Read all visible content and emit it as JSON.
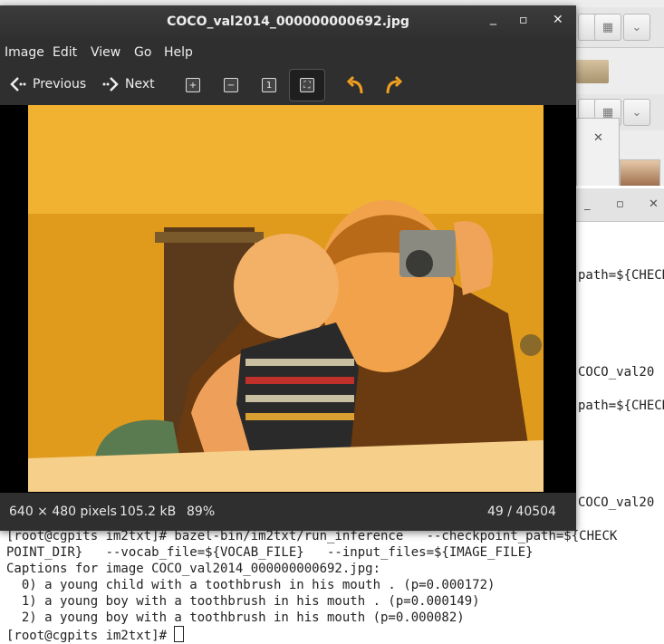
{
  "viewer": {
    "title": "COCO_val2014_000000000692.jpg",
    "controls": {
      "minimize": "_",
      "maximize": "▫",
      "close": "✕"
    },
    "menu": [
      "Image",
      "Edit",
      "View",
      "Go",
      "Help"
    ],
    "toolbar": {
      "previous": "Previous",
      "next": "Next"
    },
    "status": {
      "dimensions": "640 × 480 pixels",
      "size": "105.2 kB",
      "zoom": "89%",
      "position": "49 / 40504"
    }
  },
  "terminal": {
    "right_fragments": [
      "path=${CHECK",
      "COCO_val20",
      "path=${CHECK",
      "COCO_val20"
    ],
    "lines": [
      "[root@cgpits im2txt]# bazel-bin/im2txt/run_inference   --checkpoint_path=${CHECK",
      "POINT_DIR}   --vocab_file=${VOCAB_FILE}   --input_files=${IMAGE_FILE}",
      "Captions for image COCO_val2014_000000000692.jpg:",
      "  0) a young child with a toothbrush in his mouth . (p=0.000172)",
      "  1) a young boy with a toothbrush in his mouth . (p=0.000149)",
      "  2) a young boy with a toothbrush in his mouth (p=0.000082)"
    ],
    "prompt": "[root@cgpits im2txt]# "
  },
  "background": {
    "close": "✕",
    "minimize": "_",
    "maximize": "▫"
  },
  "colors": {
    "arrow_orange": "#f0a020",
    "viewer_bg": "#2f2f2f"
  }
}
